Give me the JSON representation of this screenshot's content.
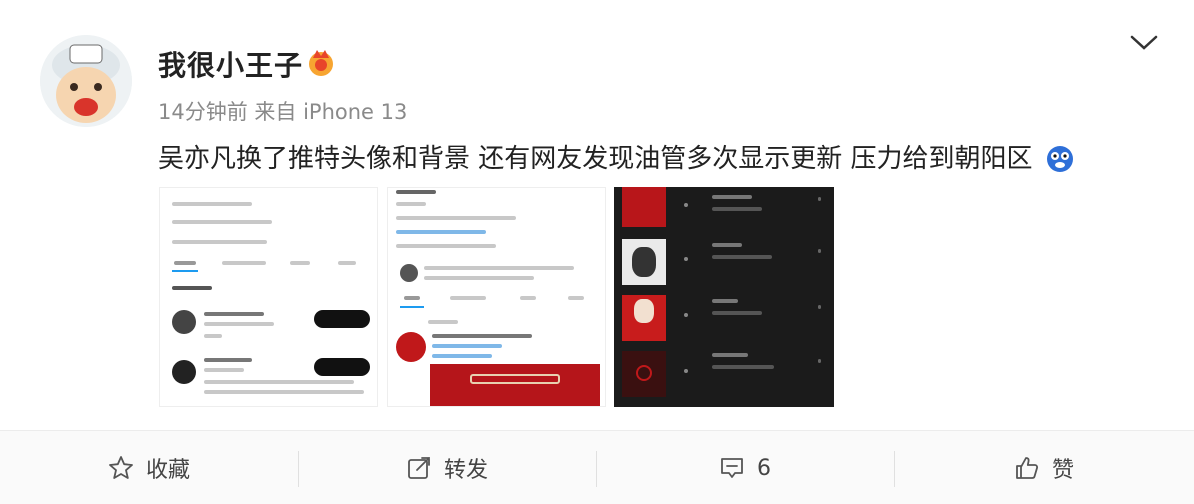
{
  "post": {
    "username": "我很小王子",
    "meta": "14分钟前 来自 iPhone 13",
    "text": "吴亦凡换了推特头像和背景 还有网友发现油管多次显示更新 压力给到朝阳区"
  },
  "actions": {
    "collect_label": "收藏",
    "repost_label": "转发",
    "comment_count": "6",
    "like_label": "赞"
  },
  "colors": {
    "accent": "#1d9bf0",
    "dark_panel": "#1b1b1b",
    "red": "#c0181a"
  },
  "icons": [
    "chevron-down-icon",
    "star-icon",
    "share-icon",
    "comment-icon",
    "thumbs-up-icon"
  ]
}
